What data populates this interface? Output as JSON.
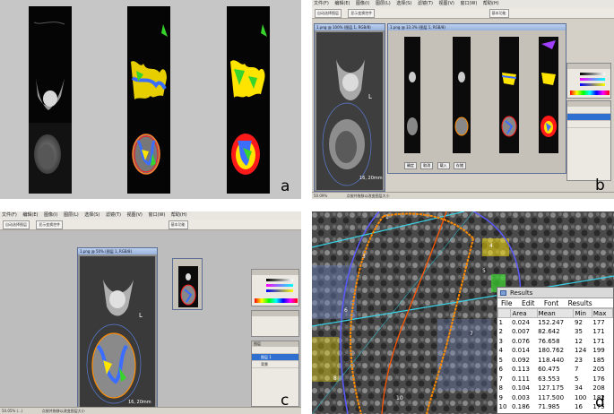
{
  "labels": {
    "a": "a",
    "b": "b",
    "c": "c",
    "d": "d"
  },
  "app": {
    "menu": [
      "文件(F)",
      "编辑(E)",
      "图像(I)",
      "图层(L)",
      "选择(S)",
      "滤镜(T)",
      "视图(V)",
      "窗口(W)",
      "帮助(H)"
    ],
    "toolbar_buttons": [
      "自动选择图层",
      "显示变换控件"
    ],
    "workspace_button": "基本功能",
    "status_left": "50.05% (...)",
    "status_right": "点按并拖移以改变图层大小"
  },
  "panel_b": {
    "doc_title": "1.png @ 100% (图层 1, RGB/8)",
    "zoom_label": "50.09%",
    "scale_text": "16, 20mm",
    "letter_L": "L",
    "sub_window_title": "1.png @ 33.3% (图层 1, RGB/8)",
    "footer_buttons": [
      "确定",
      "取消",
      "载入",
      "存储"
    ]
  },
  "panel_c": {
    "doc_title": "1.png @ 50% (图层 1, RGB/8)",
    "scale_text": "16, 20mm",
    "letter_L": "L",
    "layers_header": "图层",
    "layers": [
      "图层 1",
      "背景"
    ]
  },
  "results": {
    "title": "Results",
    "menu": [
      "File",
      "Edit",
      "Font",
      "Results"
    ],
    "columns": [
      "",
      "Area",
      "Mean",
      "Min",
      "Max"
    ],
    "rows": [
      [
        "1",
        "0.024",
        "152.247",
        "92",
        "177"
      ],
      [
        "2",
        "0.007",
        "82.642",
        "35",
        "171"
      ],
      [
        "3",
        "0.076",
        "76.658",
        "12",
        "171"
      ],
      [
        "4",
        "0.014",
        "180.762",
        "124",
        "199"
      ],
      [
        "5",
        "0.092",
        "118.440",
        "23",
        "185"
      ],
      [
        "6",
        "0.113",
        "60.475",
        "7",
        "205"
      ],
      [
        "7",
        "0.111",
        "63.553",
        "5",
        "176"
      ],
      [
        "8",
        "0.104",
        "127.175",
        "34",
        "208"
      ],
      [
        "9",
        "0.003",
        "117.500",
        "100",
        "182"
      ],
      [
        "10",
        "0.186",
        "71.985",
        "16",
        "175"
      ]
    ]
  },
  "roi_numbers": [
    "1",
    "2",
    "3",
    "4",
    "5",
    "6",
    "7",
    "8",
    "9",
    "10"
  ],
  "colors": {
    "roi_outline": "#ff8c00",
    "roi_cyan": "#39d3e6",
    "roi_blue": "#5a5aff",
    "overlay_red": "#ff1a1a",
    "overlay_yellow": "#ffe400",
    "overlay_green": "#37d42c"
  }
}
